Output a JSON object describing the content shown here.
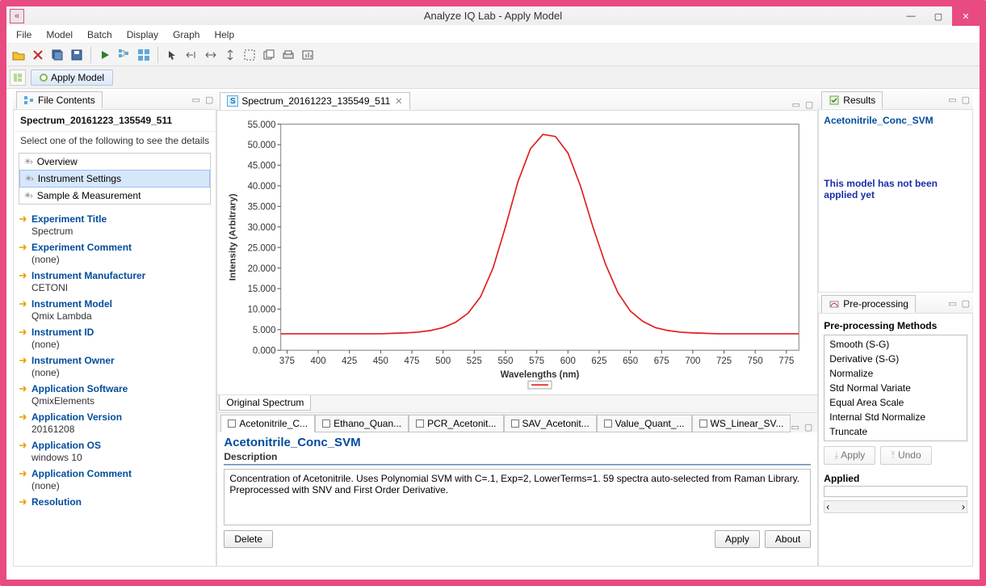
{
  "window": {
    "title": "Analyze IQ Lab - Apply Model",
    "appicon_glyph": "«"
  },
  "menus": [
    "File",
    "Model",
    "Batch",
    "Display",
    "Graph",
    "Help"
  ],
  "perspective_active": "Apply Model",
  "left_panel": {
    "tab_title": "File Contents",
    "file_name": "Spectrum_20161223_135549_511",
    "hint": "Select one of the following to see the details",
    "items": [
      {
        "label": "Overview",
        "selected": false
      },
      {
        "label": "Instrument Settings",
        "selected": true
      },
      {
        "label": "Sample & Measurement",
        "selected": false
      }
    ],
    "props": [
      {
        "key": "Experiment Title",
        "value": "Spectrum"
      },
      {
        "key": "Experiment Comment",
        "value": "(none)"
      },
      {
        "key": "Instrument Manufacturer",
        "value": "CETONI"
      },
      {
        "key": "Instrument Model",
        "value": "Qmix Lambda"
      },
      {
        "key": "Instrument ID",
        "value": "(none)"
      },
      {
        "key": "Instrument Owner",
        "value": "(none)"
      },
      {
        "key": "Application Software",
        "value": "QmixElements"
      },
      {
        "key": "Application Version",
        "value": "20161208"
      },
      {
        "key": "Application OS",
        "value": "windows 10"
      },
      {
        "key": "Application Comment",
        "value": "(none)"
      },
      {
        "key": "Resolution",
        "value": ""
      }
    ]
  },
  "editor": {
    "tab_label": "Spectrum_20161223_135549_511",
    "ylabel": "Intensity (Arbitrary)",
    "xlabel": "Wavelengths (nm)",
    "original_tab": "Original Spectrum"
  },
  "models": {
    "tabs": [
      {
        "label": "Acetonitrile_C...",
        "active": true
      },
      {
        "label": "Ethano_Quan...",
        "active": false
      },
      {
        "label": "PCR_Acetonit...",
        "active": false
      },
      {
        "label": "SAV_Acetonit...",
        "active": false
      },
      {
        "label": "Value_Quant_...",
        "active": false
      },
      {
        "label": "WS_Linear_SV...",
        "active": false
      }
    ],
    "detail_title": "Acetonitrile_Conc_SVM",
    "detail_sub": "Description",
    "detail_desc": "Concentration of Acetonitrile. Uses Polynomial SVM with C=.1, Exp=2, LowerTerms=1. 59 spectra auto-selected from Raman Library. Preprocessed with SNV and First Order Derivative.",
    "btn_delete": "Delete",
    "btn_apply": "Apply",
    "btn_about": "About"
  },
  "results": {
    "tab_title": "Results",
    "model_name": "Acetonitrile_Conc_SVM",
    "message": "This model has not been applied yet"
  },
  "preprocessing": {
    "tab_title": "Pre-processing",
    "methods_title": "Pre-processing Methods",
    "methods": [
      "Smooth (S-G)",
      "Derivative (S-G)",
      "Normalize",
      "Std Normal Variate",
      "Equal Area Scale",
      "Internal Std Normalize",
      "Truncate"
    ],
    "btn_apply": "Apply",
    "btn_undo": "Undo",
    "applied_title": "Applied"
  },
  "chart_data": {
    "type": "line",
    "title": "",
    "xlabel": "Wavelengths (nm)",
    "ylabel": "Intensity (Arbitrary)",
    "xlim": [
      370,
      785
    ],
    "ylim": [
      0,
      55
    ],
    "xticks": [
      375,
      400,
      425,
      450,
      475,
      500,
      525,
      550,
      575,
      600,
      625,
      650,
      675,
      700,
      725,
      750,
      775
    ],
    "yticks": [
      0,
      5,
      10,
      15,
      20,
      25,
      30,
      35,
      40,
      45,
      50,
      55
    ],
    "yticklabels": [
      "0.000",
      "5.000",
      "10.000",
      "15.000",
      "20.000",
      "25.000",
      "30.000",
      "35.000",
      "40.000",
      "45.000",
      "50.000",
      "55.000"
    ],
    "series": [
      {
        "name": "Original Spectrum",
        "color": "#e11d1d",
        "x": [
          370,
          380,
          390,
          400,
          410,
          420,
          430,
          440,
          450,
          460,
          470,
          480,
          490,
          500,
          510,
          520,
          530,
          540,
          550,
          560,
          570,
          580,
          590,
          600,
          610,
          620,
          630,
          640,
          650,
          660,
          670,
          680,
          690,
          700,
          710,
          720,
          730,
          740,
          750,
          760,
          770,
          780,
          785
        ],
        "y": [
          4.0,
          4.0,
          4.0,
          4.0,
          4.0,
          4.0,
          4.0,
          4.0,
          4.0,
          4.1,
          4.2,
          4.4,
          4.8,
          5.5,
          6.8,
          9.0,
          13.0,
          20.0,
          30.0,
          41.0,
          49.0,
          52.5,
          52.0,
          48.0,
          40.0,
          30.0,
          21.0,
          14.0,
          9.5,
          7.0,
          5.5,
          4.8,
          4.4,
          4.2,
          4.1,
          4.0,
          4.0,
          4.0,
          4.0,
          4.0,
          4.0,
          4.0,
          4.0
        ]
      }
    ]
  }
}
